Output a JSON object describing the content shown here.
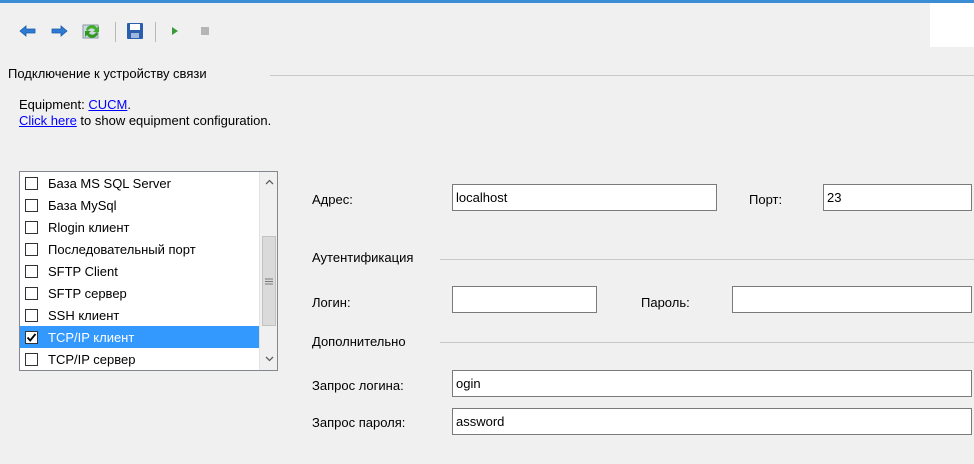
{
  "section_title": "Подключение к устройству связи",
  "equipment": {
    "prefix": "Equipment: ",
    "link": "CUCM",
    "suffix": "."
  },
  "config_link": {
    "link": "Click here",
    "rest": " to show equipment configuration."
  },
  "connection_types": [
    {
      "label": "База MS SQL Server",
      "checked": false,
      "selected": false
    },
    {
      "label": "База MySql",
      "checked": false,
      "selected": false
    },
    {
      "label": "Rlogin клиент",
      "checked": false,
      "selected": false
    },
    {
      "label": "Последовательный порт",
      "checked": false,
      "selected": false
    },
    {
      "label": "SFTP Client",
      "checked": false,
      "selected": false
    },
    {
      "label": "SFTP сервер",
      "checked": false,
      "selected": false
    },
    {
      "label": "SSH клиент",
      "checked": false,
      "selected": false
    },
    {
      "label": "TCP/IP клиент",
      "checked": true,
      "selected": true
    },
    {
      "label": "TCP/IP сервер",
      "checked": false,
      "selected": false
    }
  ],
  "address": {
    "label": "Адрес:",
    "value": "localhost"
  },
  "port": {
    "label": "Порт:",
    "value": "23"
  },
  "auth": {
    "title": "Аутентификация",
    "login_label": "Логин:",
    "login_value": "",
    "password_label": "Пароль:",
    "password_value": ""
  },
  "advanced": {
    "title": "Дополнительно",
    "login_prompt_label": "Запрос логина:",
    "login_prompt_value": "ogin",
    "password_prompt_label": "Запрос пароля:",
    "password_prompt_value": "assword"
  },
  "toolbar": {
    "buttons": [
      "back-icon",
      "forward-icon",
      "refresh-icon",
      "save-icon",
      "play-icon",
      "stop-icon"
    ]
  },
  "colors": {
    "accent": "#3b8ed6",
    "selection": "#3399ff",
    "link": "#0000ff"
  }
}
